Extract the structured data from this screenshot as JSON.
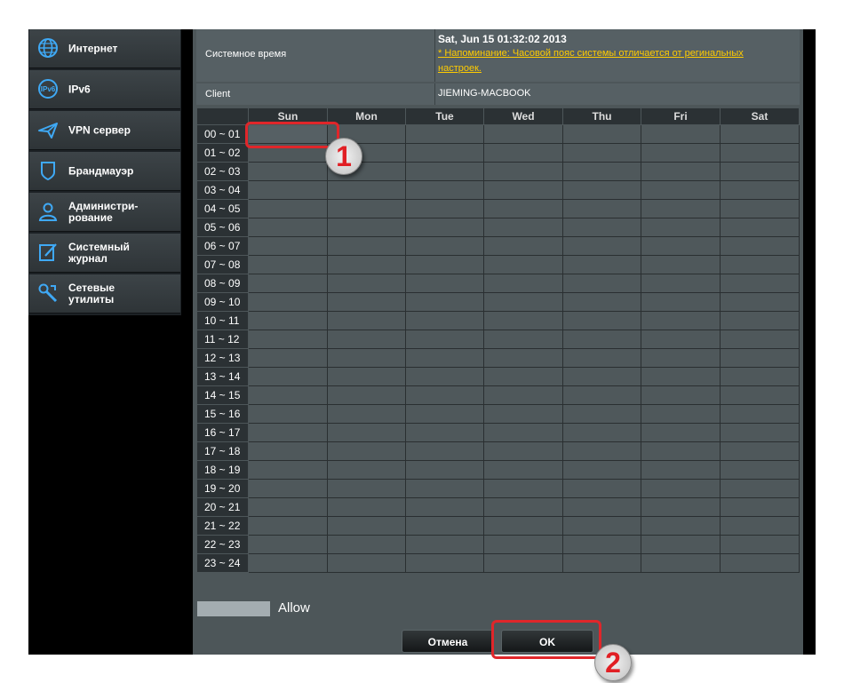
{
  "sidebar": {
    "items": [
      {
        "label": "Интернет",
        "icon": "globe-icon"
      },
      {
        "label": "IPv6",
        "icon": "ipv6-icon"
      },
      {
        "label": "VPN сервер",
        "icon": "vpn-icon"
      },
      {
        "label": "Брандмауэр",
        "icon": "shield-icon"
      },
      {
        "label": "Администри-\nрование",
        "icon": "admin-user-icon"
      },
      {
        "label": "Системный\nжурнал",
        "icon": "log-edit-icon"
      },
      {
        "label": "Сетевые\nутилиты",
        "icon": "tools-icon"
      }
    ]
  },
  "info": {
    "system_time_label": "Системное время",
    "system_time_value": "Sat, Jun 15  01:32:02  2013",
    "reminder": "* Напоминание: Часовой пояс системы отличается от регинальных настроек.",
    "client_label": "Client",
    "client_value": "JIEMING-MACBOOK"
  },
  "schedule": {
    "days": [
      "Sun",
      "Mon",
      "Tue",
      "Wed",
      "Thu",
      "Fri",
      "Sat"
    ],
    "hours": [
      "00 ~ 01",
      "01 ~ 02",
      "02 ~ 03",
      "03 ~ 04",
      "04 ~ 05",
      "05 ~ 06",
      "06 ~ 07",
      "07 ~ 08",
      "08 ~ 09",
      "09 ~ 10",
      "10 ~ 11",
      "11 ~ 12",
      "12 ~ 13",
      "13 ~ 14",
      "14 ~ 15",
      "15 ~ 16",
      "16 ~ 17",
      "17 ~ 18",
      "18 ~ 19",
      "19 ~ 20",
      "20 ~ 21",
      "21 ~ 22",
      "22 ~ 23",
      "23 ~ 24"
    ],
    "selected_cell": {
      "day": "Sun",
      "hour": "00 ~ 01"
    }
  },
  "legend": {
    "label": "Allow",
    "color": "#a4adb1"
  },
  "buttons": {
    "cancel": "Отмена",
    "ok": "OK"
  },
  "annotations": {
    "marker1": "1",
    "marker2": "2",
    "highlight_color": "#e0262a"
  }
}
